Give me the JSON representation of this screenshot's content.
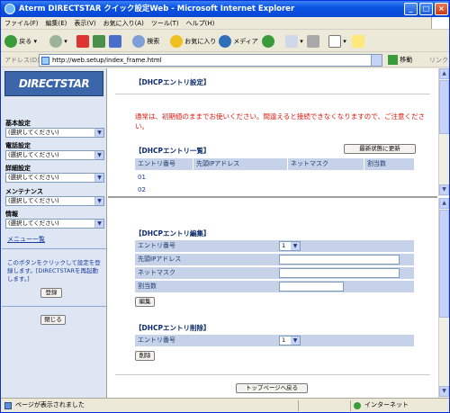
{
  "window": {
    "title": "Aterm DIRECTSTAR クイック設定Web - Microsoft Internet Explorer"
  },
  "menu": [
    "ファイル(F)",
    "編集(E)",
    "表示(V)",
    "お気に入り(A)",
    "ツール(T)",
    "ヘルプ(H)"
  ],
  "toolbar": {
    "back": "戻る",
    "search": "検索",
    "favorites": "お気に入り",
    "media": "メディア"
  },
  "address": {
    "label": "アドレス(D)",
    "url": "http://web.setup/index_frame.html",
    "go": "移動",
    "links": "リンク"
  },
  "sidebar": {
    "logo": "DIRECTSTAR",
    "sections": [
      {
        "title": "基本設定",
        "selected": "(選択してください)"
      },
      {
        "title": "電話設定",
        "selected": "(選択してください)"
      },
      {
        "title": "詳細設定",
        "selected": "(選択してください)"
      },
      {
        "title": "メンテナンス",
        "selected": "(選択してください)"
      },
      {
        "title": "情報",
        "selected": "(選択してください)"
      }
    ],
    "menu_list": "メニュー一覧",
    "note": "このボタンをクリックして設定を登録します。[DIRECTSTARを再起動します。]",
    "register": "登録",
    "close": "閉じる"
  },
  "top": {
    "heading": "【DHCPエントリ設定】",
    "warning": "通常は、初期値のままでお使いください。間違えると接続できなくなりますので、ご注意ください。",
    "list_heading": "【DHCPエントリ一覧】",
    "refresh": "最新状態に更新",
    "columns": [
      "エントリ番号",
      "先頭IPアドレス",
      "ネットマスク",
      "割当数"
    ],
    "rows": [
      "01",
      "02"
    ]
  },
  "bottom": {
    "edit_heading": "【DHCPエントリ編集】",
    "fields": {
      "entry": "エントリ番号",
      "start_ip": "先頭IPアドレス",
      "netmask": "ネットマスク",
      "count": "割当数"
    },
    "entry_value": "1",
    "edit_button": "編集",
    "delete_heading": "【DHCPエントリ削除】",
    "delete_entry_label": "エントリ番号",
    "delete_entry_value": "1",
    "delete_button": "削除",
    "top_button": "トップページへ戻る"
  },
  "status": {
    "left": "ページが表示されました",
    "right": "インターネット"
  }
}
